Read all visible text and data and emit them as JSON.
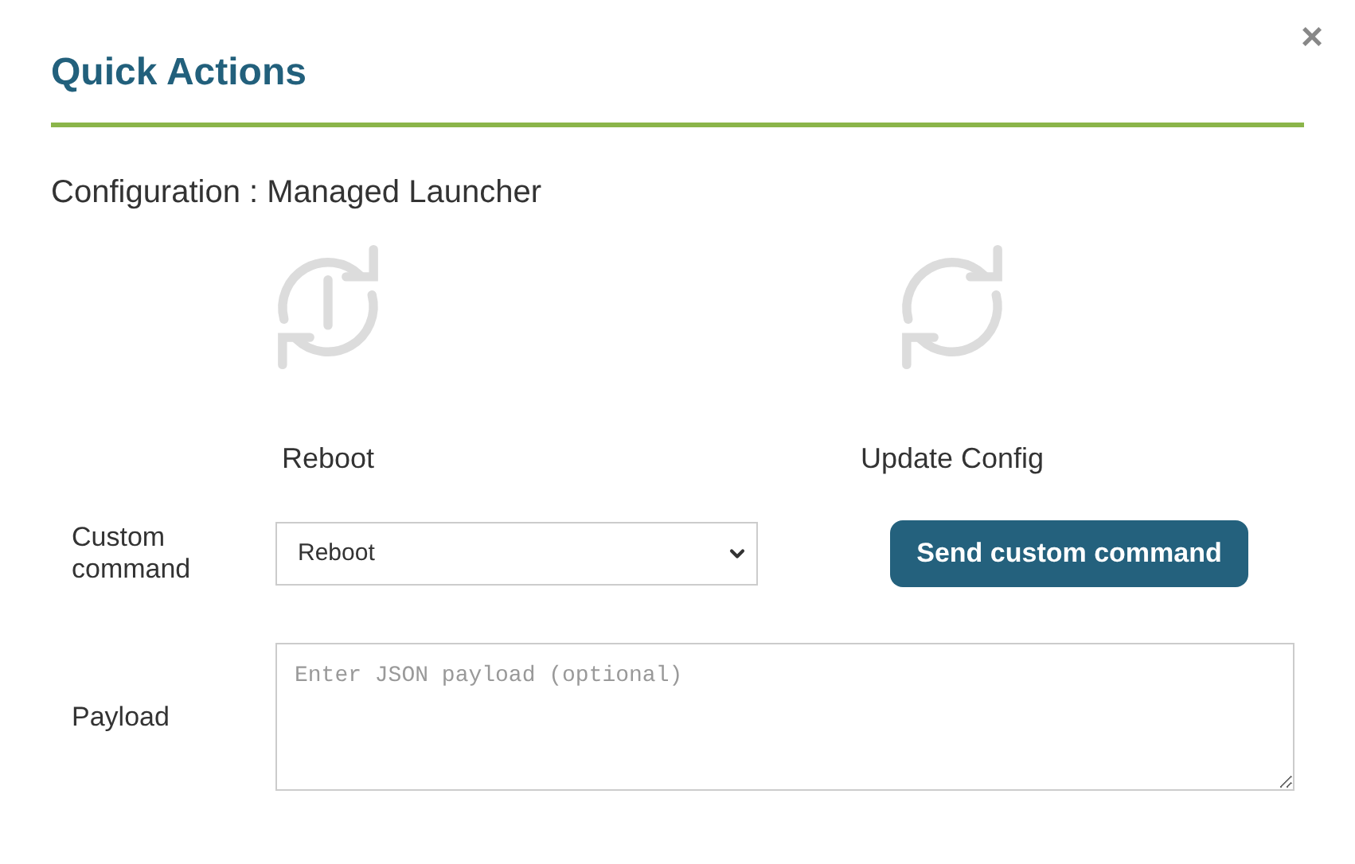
{
  "dialog": {
    "title": "Quick Actions",
    "close": "×",
    "configuration": "Configuration : Managed Launcher"
  },
  "actions": [
    {
      "kind": "reboot",
      "label": "Reboot"
    },
    {
      "kind": "update",
      "label": "Update Config"
    }
  ],
  "custom_command": {
    "label": "Custom command",
    "value": "Reboot",
    "button": "Send custom command"
  },
  "payload": {
    "label": "Payload",
    "placeholder": "Enter JSON payload (optional)"
  }
}
